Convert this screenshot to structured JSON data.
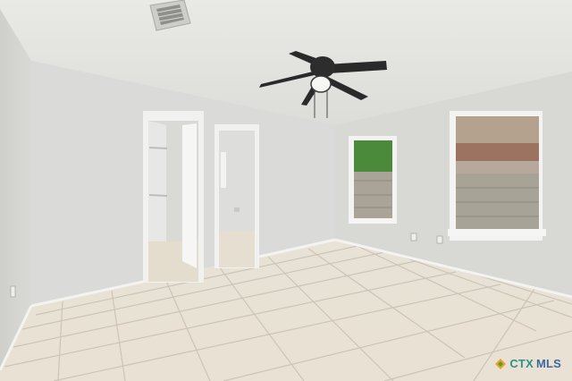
{
  "photo": {
    "scene": "empty-bedroom",
    "watermark": {
      "part1": "CTX",
      "part2": "MLS",
      "colors": {
        "part1": "#2f8f8a",
        "part2": "#3b6aa0",
        "logo_a": "#f0a21f",
        "logo_b": "#49a14b"
      }
    },
    "colors": {
      "ceiling": "#e6e6e3",
      "wall_left": "#d5d5d3",
      "wall_back": "#dadad8",
      "wall_right": "#d8d8d6",
      "floor": "#e7dfd2",
      "grout": "#c9c0b2",
      "trim": "#f4f4f2",
      "fan": "#2b2b2b"
    }
  }
}
